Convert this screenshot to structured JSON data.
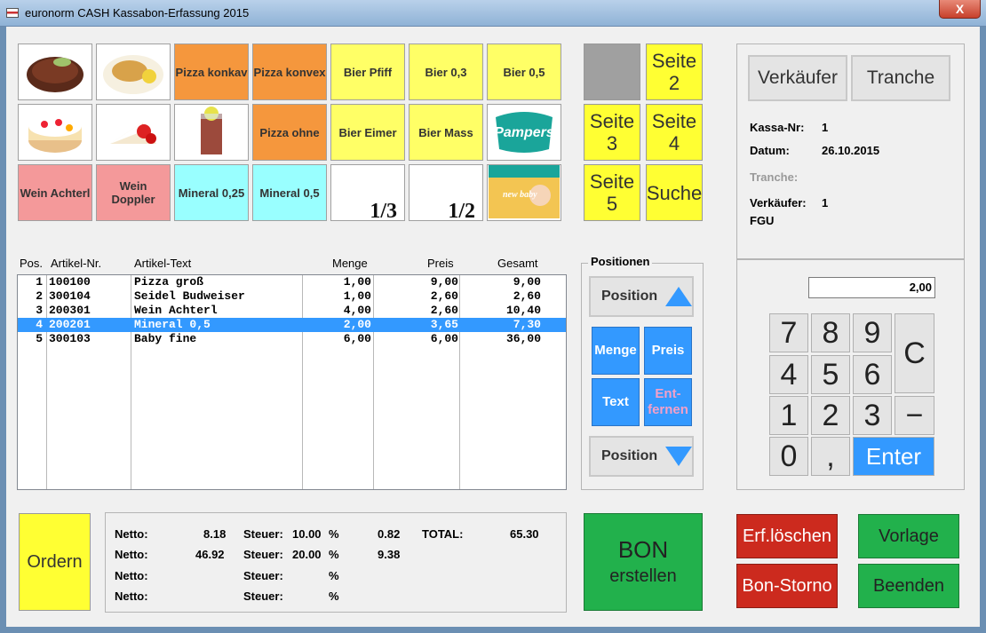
{
  "window": {
    "title": "euronorm CASH Kassabon-Erfassung 2015",
    "close": "X"
  },
  "tiles": [
    {
      "label": "",
      "color": "photo",
      "icon": "steak-photo"
    },
    {
      "label": "",
      "color": "photo",
      "icon": "schnitzel-photo"
    },
    {
      "label": "Pizza konkav",
      "color": "orange"
    },
    {
      "label": "Pizza konvex",
      "color": "orange"
    },
    {
      "label": "Bier Pfiff",
      "color": "yellow"
    },
    {
      "label": "Bier 0,3",
      "color": "yellow"
    },
    {
      "label": "Bier 0,5",
      "color": "yellow"
    },
    {
      "label": "",
      "color": "photo",
      "icon": "cake-photo"
    },
    {
      "label": "",
      "color": "photo",
      "icon": "strawberry-cake-photo"
    },
    {
      "label": "",
      "color": "photo",
      "icon": "iced-tea-photo"
    },
    {
      "label": "Pizza ohne",
      "color": "orange"
    },
    {
      "label": "Bier Eimer",
      "color": "yellow"
    },
    {
      "label": "Bier Mass",
      "color": "yellow"
    },
    {
      "label": "Pampers",
      "color": "photo",
      "icon": "pampers-logo"
    },
    {
      "label": "Wein Achterl",
      "color": "pink"
    },
    {
      "label": "Wein Doppler",
      "color": "pink"
    },
    {
      "label": "Mineral 0,25",
      "color": "cyan"
    },
    {
      "label": "Mineral 0,5",
      "color": "cyan"
    },
    {
      "label": "1/3",
      "color": "white",
      "icon": "beer-glass-photo"
    },
    {
      "label": "1/2",
      "color": "white",
      "icon": "beer-mug-photo"
    },
    {
      "label": "new baby",
      "color": "photo",
      "icon": "pampers-new-baby-photo"
    }
  ],
  "seiten": {
    "seite2": "Seite 2",
    "seite3": "Seite 3",
    "seite4": "Seite 4",
    "seite5": "Seite 5",
    "suche": "Suche"
  },
  "table": {
    "headers": {
      "pos": "Pos.",
      "artnr": "Artikel-Nr.",
      "text": "Artikel-Text",
      "menge": "Menge",
      "preis": "Preis",
      "gesamt": "Gesamt"
    },
    "rows": [
      {
        "pos": "1",
        "artnr": "100100",
        "text": "Pizza groß",
        "menge": "1,00",
        "preis": "9,00",
        "gesamt": "9,00"
      },
      {
        "pos": "2",
        "artnr": "300104",
        "text": "Seidel Budweiser",
        "menge": "1,00",
        "preis": "2,60",
        "gesamt": "2,60"
      },
      {
        "pos": "3",
        "artnr": "200301",
        "text": "Wein Achterl",
        "menge": "4,00",
        "preis": "2,60",
        "gesamt": "10,40"
      },
      {
        "pos": "4",
        "artnr": "200201",
        "text": "Mineral 0,5",
        "menge": "2,00",
        "preis": "3,65",
        "gesamt": "7,30"
      },
      {
        "pos": "5",
        "artnr": "300103",
        "text": "Baby fine",
        "menge": "6,00",
        "preis": "6,00",
        "gesamt": "36,00"
      }
    ]
  },
  "positionen": {
    "title": "Positionen",
    "up": "Position",
    "menge": "Menge",
    "preis": "Preis",
    "text": "Text",
    "entfernen": "Ent- fernen",
    "down": "Position"
  },
  "info": {
    "verkaeufer_btn": "Verkäufer",
    "tranche_btn": "Tranche",
    "kassa_label": "Kassa-Nr:",
    "kassa_value": "1",
    "datum_label": "Datum:",
    "datum_value": "26.10.2015",
    "tranche_label": "Tranche:",
    "verkaeufer_label": "Verkäufer:",
    "verkaeufer_value": "1",
    "verkaeufer_name": "FGU"
  },
  "keypad": {
    "display": "2,00",
    "k7": "7",
    "k8": "8",
    "k9": "9",
    "kc": "C",
    "k4": "4",
    "k5": "5",
    "k6": "6",
    "k1": "1",
    "k2": "2",
    "k3": "3",
    "kminus": "−",
    "k0": "0",
    "kcomma": ",",
    "enter": "Enter"
  },
  "footer": {
    "ordern": "Ordern",
    "netto": "Netto:",
    "steuer": "Steuer:",
    "pct": "%",
    "n1": "8.18",
    "s1": "10.00",
    "t1": "0.82",
    "n2": "46.92",
    "s2": "20.00",
    "t2": "9.38",
    "total_label": "TOTAL:",
    "total_value": "65.30",
    "bon_line1": "BON",
    "bon_line2": "erstellen",
    "erf_loeschen": "Erf.löschen",
    "bon_storno": "Bon-Storno",
    "vorlage": "Vorlage",
    "beenden": "Beenden"
  },
  "colors": {
    "orange": "#f5973d",
    "yellow": "#ffff66",
    "pink": "#f4999a",
    "cyan": "#99ffff",
    "blue": "#3399ff",
    "green": "#22b14c",
    "red": "#cc2a1e",
    "seite_yellow": "#ffff33"
  }
}
